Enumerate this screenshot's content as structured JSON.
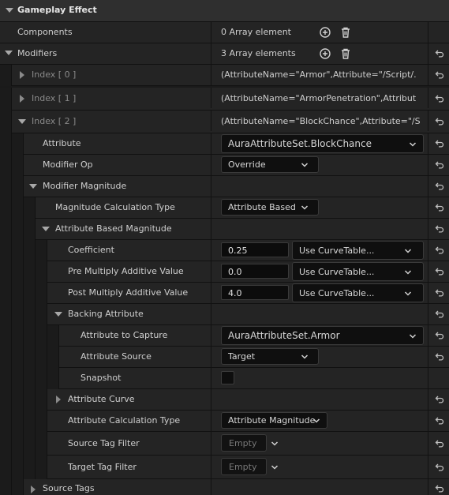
{
  "header": {
    "title": "Gameplay Effect"
  },
  "rows": {
    "components": {
      "label": "Components",
      "value": "0 Array element"
    },
    "modifiers": {
      "label": "Modifiers",
      "value": "3 Array elements"
    },
    "index0": {
      "label": "Index [ 0 ]",
      "value": "(AttributeName=\"Armor\",Attribute=\"/Script/."
    },
    "index1": {
      "label": "Index [ 1 ]",
      "value": "(AttributeName=\"ArmorPenetration\",Attribut"
    },
    "index2": {
      "label": "Index [ 2 ]",
      "value": "(AttributeName=\"BlockChance\",Attribute=\"/S"
    },
    "attribute": {
      "label": "Attribute",
      "value": "AuraAttributeSet.BlockChance"
    },
    "modifier_op": {
      "label": "Modifier Op",
      "value": "Override"
    },
    "modifier_magnitude": {
      "label": "Modifier Magnitude"
    },
    "magnitude_calc_type": {
      "label": "Magnitude Calculation Type",
      "value": "Attribute Based"
    },
    "attribute_based_magnitude": {
      "label": "Attribute Based Magnitude"
    },
    "coefficient": {
      "label": "Coefficient",
      "value": "0.25",
      "curve": "Use CurveTable..."
    },
    "pre_multiply": {
      "label": "Pre Multiply Additive Value",
      "value": "0.0",
      "curve": "Use CurveTable..."
    },
    "post_multiply": {
      "label": "Post Multiply Additive Value",
      "value": "4.0",
      "curve": "Use CurveTable..."
    },
    "backing_attribute": {
      "label": "Backing Attribute"
    },
    "attribute_to_capture": {
      "label": "Attribute to Capture",
      "value": "AuraAttributeSet.Armor"
    },
    "attribute_source": {
      "label": "Attribute Source",
      "value": "Target"
    },
    "snapshot": {
      "label": "Snapshot",
      "checked": false
    },
    "attribute_curve": {
      "label": "Attribute Curve"
    },
    "attribute_calc_type": {
      "label": "Attribute Calculation Type",
      "value": "Attribute Magnitude"
    },
    "source_tag_filter": {
      "label": "Source Tag Filter",
      "placeholder": "Empty"
    },
    "target_tag_filter": {
      "label": "Target Tag Filter",
      "placeholder": "Empty"
    },
    "source_tags": {
      "label": "Source Tags"
    }
  },
  "icons": {
    "add": "add-circle-icon",
    "delete": "trash-icon",
    "reset": "reset-to-default-icon",
    "dropdown": "chevron-down-icon"
  },
  "colors": {
    "panel": "#242424",
    "header": "#2f2f2f",
    "field": "#0f0f0f",
    "text": "#cfcfcf"
  }
}
